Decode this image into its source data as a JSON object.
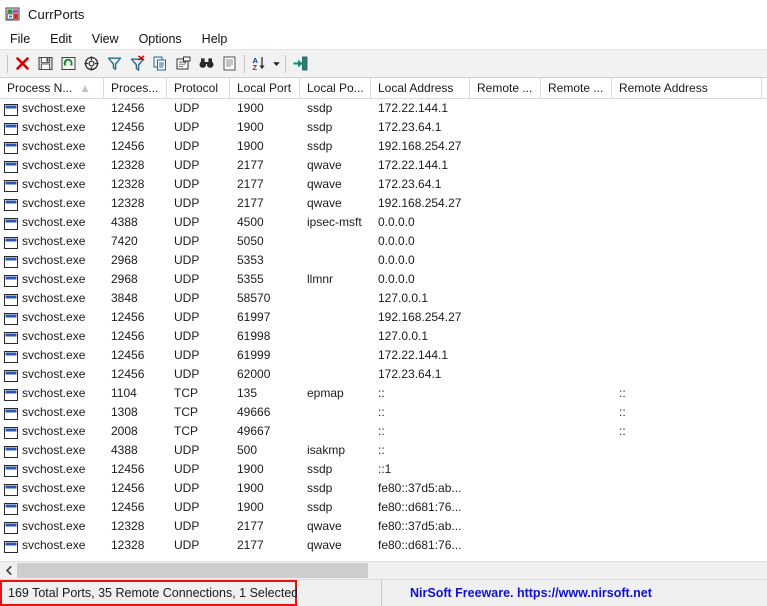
{
  "window": {
    "title": "CurrPorts",
    "icon": "currports-app-icon"
  },
  "menu": {
    "items": [
      {
        "label": "File"
      },
      {
        "label": "Edit"
      },
      {
        "label": "View"
      },
      {
        "label": "Options"
      },
      {
        "label": "Help"
      }
    ]
  },
  "toolbar": {
    "buttons": [
      {
        "name": "close-connection-icon",
        "tooltip": "Close Selected TCP Connections"
      },
      {
        "name": "save-icon",
        "tooltip": "Save Selected Items"
      },
      {
        "name": "refresh-icon",
        "tooltip": "Refresh"
      },
      {
        "name": "target-icon",
        "tooltip": "Auto Refresh"
      },
      {
        "name": "filter-icon",
        "tooltip": "Advanced Filters"
      },
      {
        "name": "clear-filter-icon",
        "tooltip": "Clear Filters"
      },
      {
        "name": "copy-icon",
        "tooltip": "Copy Selected Items"
      },
      {
        "name": "properties-icon",
        "tooltip": "Properties"
      },
      {
        "name": "find-icon",
        "tooltip": "Find"
      },
      {
        "name": "html-report-icon",
        "tooltip": "HTML Report - All Items"
      },
      {
        "name": "sort-az-icon",
        "tooltip": "Sort By"
      },
      {
        "name": "sort-dropdown-arrow-icon",
        "tooltip": "Sort By Menu"
      },
      {
        "name": "exit-icon",
        "tooltip": "Exit"
      }
    ]
  },
  "table": {
    "columns": [
      {
        "key": "process_name",
        "label": "Process N...",
        "width": 104,
        "sorted": "asc"
      },
      {
        "key": "process_id",
        "label": "Proces...",
        "width": 63
      },
      {
        "key": "protocol",
        "label": "Protocol",
        "width": 63
      },
      {
        "key": "local_port",
        "label": "Local Port",
        "width": 70
      },
      {
        "key": "local_port_name",
        "label": "Local Po...",
        "width": 71
      },
      {
        "key": "local_address",
        "label": "Local Address",
        "width": 99
      },
      {
        "key": "remote_port",
        "label": "Remote ...",
        "width": 71
      },
      {
        "key": "remote_port_name",
        "label": "Remote ...",
        "width": 71
      },
      {
        "key": "remote_address",
        "label": "Remote Address",
        "width": 150
      }
    ],
    "rows": [
      {
        "process_name": "svchost.exe",
        "process_id": "12456",
        "protocol": "UDP",
        "local_port": "1900",
        "local_port_name": "ssdp",
        "local_address": "172.22.144.1",
        "remote_port": "",
        "remote_port_name": "",
        "remote_address": ""
      },
      {
        "process_name": "svchost.exe",
        "process_id": "12456",
        "protocol": "UDP",
        "local_port": "1900",
        "local_port_name": "ssdp",
        "local_address": "172.23.64.1",
        "remote_port": "",
        "remote_port_name": "",
        "remote_address": ""
      },
      {
        "process_name": "svchost.exe",
        "process_id": "12456",
        "protocol": "UDP",
        "local_port": "1900",
        "local_port_name": "ssdp",
        "local_address": "192.168.254.27",
        "remote_port": "",
        "remote_port_name": "",
        "remote_address": ""
      },
      {
        "process_name": "svchost.exe",
        "process_id": "12328",
        "protocol": "UDP",
        "local_port": "2177",
        "local_port_name": "qwave",
        "local_address": "172.22.144.1",
        "remote_port": "",
        "remote_port_name": "",
        "remote_address": ""
      },
      {
        "process_name": "svchost.exe",
        "process_id": "12328",
        "protocol": "UDP",
        "local_port": "2177",
        "local_port_name": "qwave",
        "local_address": "172.23.64.1",
        "remote_port": "",
        "remote_port_name": "",
        "remote_address": ""
      },
      {
        "process_name": "svchost.exe",
        "process_id": "12328",
        "protocol": "UDP",
        "local_port": "2177",
        "local_port_name": "qwave",
        "local_address": "192.168.254.27",
        "remote_port": "",
        "remote_port_name": "",
        "remote_address": ""
      },
      {
        "process_name": "svchost.exe",
        "process_id": "4388",
        "protocol": "UDP",
        "local_port": "4500",
        "local_port_name": "ipsec-msft",
        "local_address": "0.0.0.0",
        "remote_port": "",
        "remote_port_name": "",
        "remote_address": ""
      },
      {
        "process_name": "svchost.exe",
        "process_id": "7420",
        "protocol": "UDP",
        "local_port": "5050",
        "local_port_name": "",
        "local_address": "0.0.0.0",
        "remote_port": "",
        "remote_port_name": "",
        "remote_address": ""
      },
      {
        "process_name": "svchost.exe",
        "process_id": "2968",
        "protocol": "UDP",
        "local_port": "5353",
        "local_port_name": "",
        "local_address": "0.0.0.0",
        "remote_port": "",
        "remote_port_name": "",
        "remote_address": ""
      },
      {
        "process_name": "svchost.exe",
        "process_id": "2968",
        "protocol": "UDP",
        "local_port": "5355",
        "local_port_name": "llmnr",
        "local_address": "0.0.0.0",
        "remote_port": "",
        "remote_port_name": "",
        "remote_address": ""
      },
      {
        "process_name": "svchost.exe",
        "process_id": "3848",
        "protocol": "UDP",
        "local_port": "58570",
        "local_port_name": "",
        "local_address": "127.0.0.1",
        "remote_port": "",
        "remote_port_name": "",
        "remote_address": ""
      },
      {
        "process_name": "svchost.exe",
        "process_id": "12456",
        "protocol": "UDP",
        "local_port": "61997",
        "local_port_name": "",
        "local_address": "192.168.254.27",
        "remote_port": "",
        "remote_port_name": "",
        "remote_address": ""
      },
      {
        "process_name": "svchost.exe",
        "process_id": "12456",
        "protocol": "UDP",
        "local_port": "61998",
        "local_port_name": "",
        "local_address": "127.0.0.1",
        "remote_port": "",
        "remote_port_name": "",
        "remote_address": ""
      },
      {
        "process_name": "svchost.exe",
        "process_id": "12456",
        "protocol": "UDP",
        "local_port": "61999",
        "local_port_name": "",
        "local_address": "172.22.144.1",
        "remote_port": "",
        "remote_port_name": "",
        "remote_address": ""
      },
      {
        "process_name": "svchost.exe",
        "process_id": "12456",
        "protocol": "UDP",
        "local_port": "62000",
        "local_port_name": "",
        "local_address": "172.23.64.1",
        "remote_port": "",
        "remote_port_name": "",
        "remote_address": ""
      },
      {
        "process_name": "svchost.exe",
        "process_id": "1104",
        "protocol": "TCP",
        "local_port": "135",
        "local_port_name": "epmap",
        "local_address": "::",
        "remote_port": "",
        "remote_port_name": "",
        "remote_address": "::"
      },
      {
        "process_name": "svchost.exe",
        "process_id": "1308",
        "protocol": "TCP",
        "local_port": "49666",
        "local_port_name": "",
        "local_address": "::",
        "remote_port": "",
        "remote_port_name": "",
        "remote_address": "::"
      },
      {
        "process_name": "svchost.exe",
        "process_id": "2008",
        "protocol": "TCP",
        "local_port": "49667",
        "local_port_name": "",
        "local_address": "::",
        "remote_port": "",
        "remote_port_name": "",
        "remote_address": "::"
      },
      {
        "process_name": "svchost.exe",
        "process_id": "4388",
        "protocol": "UDP",
        "local_port": "500",
        "local_port_name": "isakmp",
        "local_address": "::",
        "remote_port": "",
        "remote_port_name": "",
        "remote_address": ""
      },
      {
        "process_name": "svchost.exe",
        "process_id": "12456",
        "protocol": "UDP",
        "local_port": "1900",
        "local_port_name": "ssdp",
        "local_address": "::1",
        "remote_port": "",
        "remote_port_name": "",
        "remote_address": ""
      },
      {
        "process_name": "svchost.exe",
        "process_id": "12456",
        "protocol": "UDP",
        "local_port": "1900",
        "local_port_name": "ssdp",
        "local_address": "fe80::37d5:ab...",
        "remote_port": "",
        "remote_port_name": "",
        "remote_address": ""
      },
      {
        "process_name": "svchost.exe",
        "process_id": "12456",
        "protocol": "UDP",
        "local_port": "1900",
        "local_port_name": "ssdp",
        "local_address": "fe80::d681:76...",
        "remote_port": "",
        "remote_port_name": "",
        "remote_address": ""
      },
      {
        "process_name": "svchost.exe",
        "process_id": "12328",
        "protocol": "UDP",
        "local_port": "2177",
        "local_port_name": "qwave",
        "local_address": "fe80::37d5:ab...",
        "remote_port": "",
        "remote_port_name": "",
        "remote_address": ""
      },
      {
        "process_name": "svchost.exe",
        "process_id": "12328",
        "protocol": "UDP",
        "local_port": "2177",
        "local_port_name": "qwave",
        "local_address": "fe80::d681:76...",
        "remote_port": "",
        "remote_port_name": "",
        "remote_address": ""
      }
    ]
  },
  "scrollbar": {
    "left_arrow": "‹"
  },
  "statusbar": {
    "summary": "169 Total Ports, 35 Remote Connections, 1 Selected",
    "link": "NirSoft Freeware. https://www.nirsoft.net",
    "highlight_color": "#e8120e",
    "link_color": "#1111cc"
  }
}
